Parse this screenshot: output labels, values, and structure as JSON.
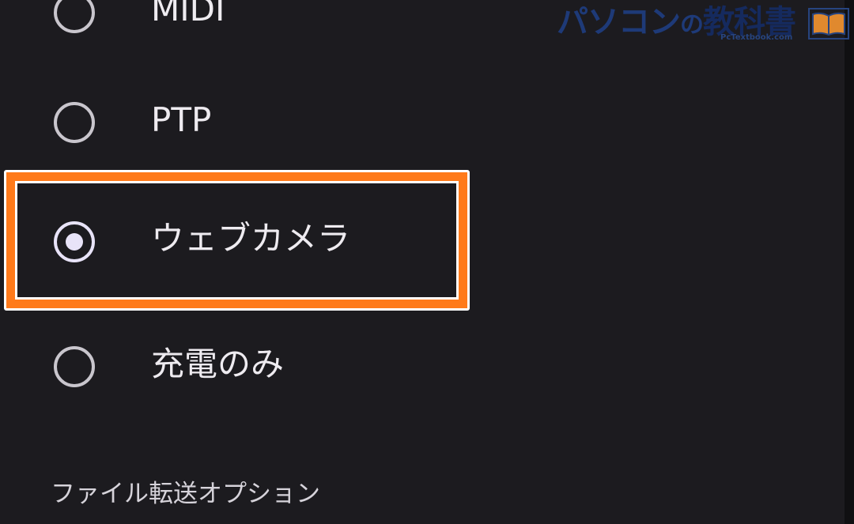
{
  "usb_options": [
    {
      "label": "MIDI",
      "selected": false
    },
    {
      "label": "PTP",
      "selected": false
    },
    {
      "label": "ウェブカメラ",
      "selected": true
    },
    {
      "label": "充電のみ",
      "selected": false
    }
  ],
  "file_transfer_section": {
    "header": "ファイル転送オプション"
  },
  "highlight": {
    "color": "#ff7a1a",
    "target": "ウェブカメラ"
  },
  "watermark": {
    "text_kana": "パソコン",
    "text_no": "の",
    "text_kanji": "教科書",
    "url": "PcTextbook.com",
    "icon": "open-book-icon",
    "color": "#1e3a78"
  }
}
